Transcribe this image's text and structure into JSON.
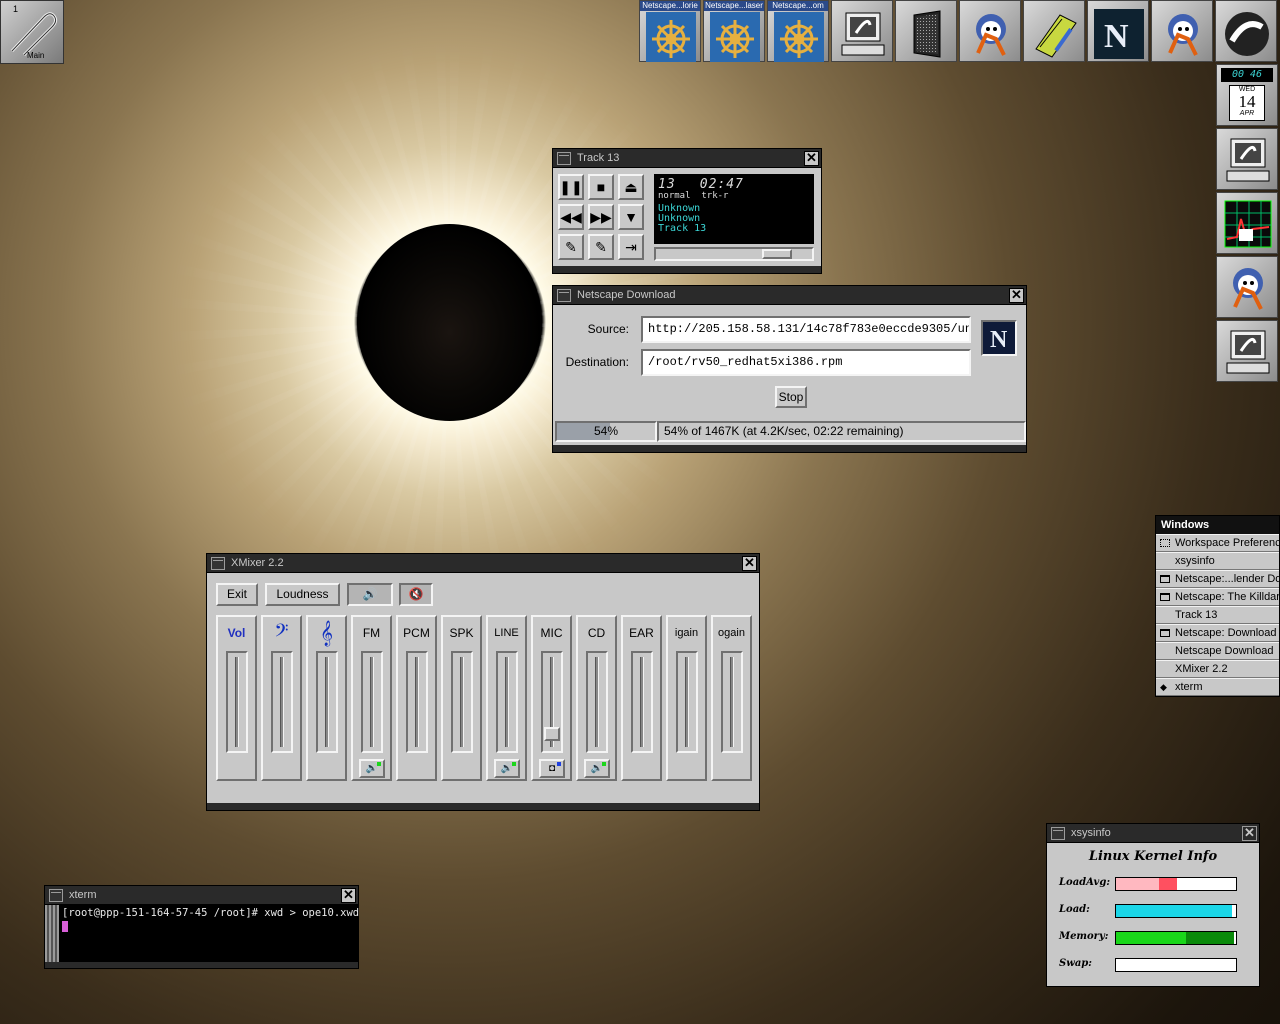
{
  "desktop": {
    "workspace_number": "1",
    "workspace_name": "Main"
  },
  "dock": {
    "top_tiles": [
      {
        "label": "Netscape...lorie",
        "icon": "ship-wheel-icon"
      },
      {
        "label": "Netscape...laser",
        "icon": "ship-wheel-icon"
      },
      {
        "label": "Netscape...om",
        "icon": "ship-wheel-icon"
      },
      {
        "label": "",
        "icon": "computer-icon"
      },
      {
        "label": "",
        "icon": "speaker-icon"
      },
      {
        "label": "",
        "icon": "gimp-icon"
      },
      {
        "label": "",
        "icon": "notepad-icon"
      },
      {
        "label": "",
        "icon": "netscape-n-icon"
      },
      {
        "label": "",
        "icon": "gimp-icon"
      },
      {
        "label": "",
        "icon": "nextstep-icon"
      }
    ],
    "clock": {
      "time": "00 46",
      "weekday": "WED",
      "day": "14",
      "month": "APR"
    }
  },
  "cd_player": {
    "title": "Track 13",
    "track": "13",
    "time": "02:47",
    "mode": "normal",
    "mode2": "trk-r",
    "artist": "Unknown",
    "album": "Unknown",
    "track_name": "Track 13"
  },
  "download": {
    "title": "Netscape Download",
    "source_label": "Source:",
    "source_value": "http://205.158.58.131/14c78f783e0eccde9305/un",
    "destination_label": "Destination:",
    "destination_value": "/root/rv50_redhat5xi386.rpm",
    "stop_label": "Stop",
    "percent_text": "54%",
    "progress": 0.54,
    "status": "54% of 1467K (at 4.2K/sec, 02:22 remaining)"
  },
  "mixer": {
    "title": "XMixer 2.2",
    "exit_label": "Exit",
    "loudness_label": "Loudness",
    "channels": [
      {
        "name": "vol-channel",
        "icon_text": "Vol",
        "level": 0.0,
        "rec": false
      },
      {
        "name": "bass-channel",
        "icon_text": "𝄢",
        "level": 0.0,
        "rec": false
      },
      {
        "name": "treble-channel",
        "icon_text": "𝄞",
        "level": 0.0,
        "rec": false
      },
      {
        "name": "fm-synth-channel",
        "icon_text": "FM",
        "level": 0.0,
        "rec": true
      },
      {
        "name": "pcm-channel",
        "icon_text": "PCM",
        "level": 0.0,
        "rec": false
      },
      {
        "name": "speaker-channel",
        "icon_text": "SPK",
        "level": 0.0,
        "rec": false
      },
      {
        "name": "line-channel",
        "icon_text": "LINE",
        "level": 0.0,
        "rec": true
      },
      {
        "name": "mic-channel",
        "icon_text": "MIC",
        "level": 0.12,
        "rec": true
      },
      {
        "name": "cd-channel",
        "icon_text": "CD",
        "level": 0.0,
        "rec": true
      },
      {
        "name": "monitor-channel",
        "icon_text": "EAR",
        "level": 0.0,
        "rec": false
      },
      {
        "name": "igain-channel",
        "icon_text": "igain",
        "level": 0.0,
        "rec": false
      },
      {
        "name": "ogain-channel",
        "icon_text": "ogain",
        "level": 0.0,
        "rec": false
      }
    ]
  },
  "windows_list": {
    "title": "Windows",
    "items": [
      {
        "label": "Workspace Preferences",
        "marker": "workspace"
      },
      {
        "label": "xsysinfo",
        "marker": ""
      },
      {
        "label": "Netscape:...lender Dow",
        "marker": "window"
      },
      {
        "label": "Netscape: The Killdares",
        "marker": "window"
      },
      {
        "label": "Track 13",
        "marker": ""
      },
      {
        "label": "Netscape: Download R",
        "marker": "window"
      },
      {
        "label": "Netscape Download",
        "marker": ""
      },
      {
        "label": "XMixer 2.2",
        "marker": ""
      },
      {
        "label": "xterm",
        "marker": "diamond"
      }
    ]
  },
  "xsysinfo": {
    "title": "xsysinfo",
    "heading": "Linux Kernel Info",
    "rows": [
      {
        "label": "LoadAvg:",
        "color": "#ffb8c0",
        "fill": 0.51,
        "accent": "#ff5060",
        "accent_fill": 0.15
      },
      {
        "label": "Load:",
        "color": "#1ad6e8",
        "fill": 0.97,
        "accent": "",
        "accent_fill": 0
      },
      {
        "label": "Memory:",
        "color": "#1ad61a",
        "fill": 0.98,
        "accent": "#0a8a0a",
        "accent_fill": 0.4
      },
      {
        "label": "Swap:",
        "color": "#ffffff",
        "fill": 0,
        "accent": "",
        "accent_fill": 0
      }
    ]
  },
  "xterm": {
    "title": "xterm",
    "line1": "[root@ppp-151-164-57-45 /root]# xwd > ope10.xwd"
  }
}
